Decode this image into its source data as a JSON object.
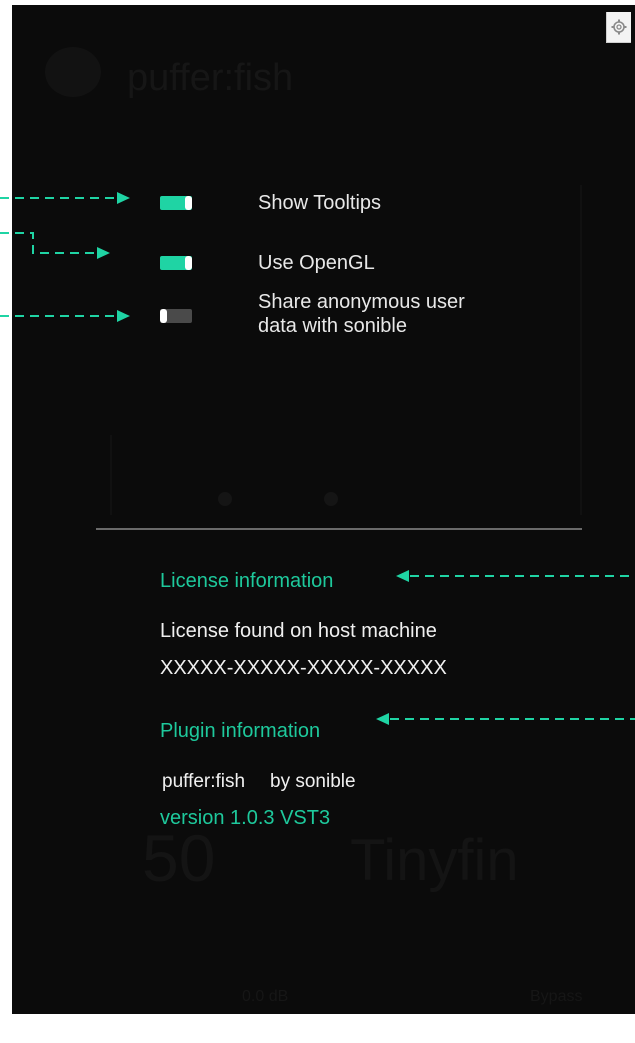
{
  "background": {
    "brand_text": "puffer:fish",
    "big_number": "50",
    "big_name": "Tinyfin",
    "db_readout": "0.0 dB",
    "bypass_label": "Bypass"
  },
  "settings": {
    "icon": "gear-icon",
    "options": [
      {
        "label": "Show Tooltips",
        "state": "on"
      },
      {
        "label": "Use OpenGL",
        "state": "on"
      },
      {
        "label": "Share anonymous user data with sonible",
        "line1": "Share anonymous user",
        "line2": "data with sonible",
        "state": "off"
      }
    ]
  },
  "license": {
    "title": "License information",
    "status": "License found on host machine",
    "key": "XXXXX-XXXXX-XXXXX-XXXXX"
  },
  "plugin": {
    "title": "Plugin information",
    "name": "puffer:fish",
    "by": "by sonible",
    "version": "version 1.0.3 VST3"
  },
  "colors": {
    "accent": "#1fd4a4",
    "panel_bg": "#0b0b0b",
    "text": "#e8e8e8",
    "toggle_off": "#4a4a4a",
    "divider": "#6a6a6a"
  }
}
